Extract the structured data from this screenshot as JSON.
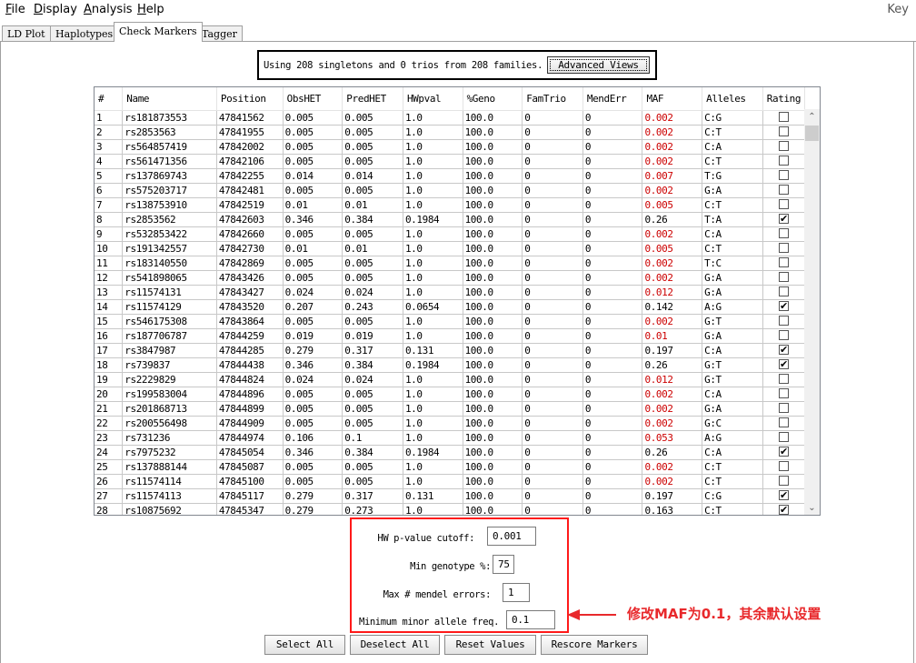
{
  "menubar": {
    "items": [
      "File",
      "Display",
      "Analysis",
      "Help"
    ],
    "right_label": "Key"
  },
  "tabs": [
    "LD Plot",
    "Haplotypes",
    "Check Markers",
    "Tagger"
  ],
  "active_tab": "Check Markers",
  "info": {
    "text": "Using 208 singletons and 0 trios from 208 families.",
    "advanced_button": "Advanced Views"
  },
  "table": {
    "columns": [
      "#",
      "Name",
      "Position",
      "ObsHET",
      "PredHET",
      "HWpval",
      "%Geno",
      "FamTrio",
      "MendErr",
      "MAF",
      "Alleles",
      "Rating"
    ],
    "rows": [
      [
        "1",
        "rs181873553",
        "47841562",
        "0.005",
        "0.005",
        "1.0",
        "100.0",
        "0",
        "0",
        "0.002",
        "C:G",
        false
      ],
      [
        "2",
        "rs2853563",
        "47841955",
        "0.005",
        "0.005",
        "1.0",
        "100.0",
        "0",
        "0",
        "0.002",
        "C:T",
        false
      ],
      [
        "3",
        "rs564857419",
        "47842002",
        "0.005",
        "0.005",
        "1.0",
        "100.0",
        "0",
        "0",
        "0.002",
        "C:A",
        false
      ],
      [
        "4",
        "rs561471356",
        "47842106",
        "0.005",
        "0.005",
        "1.0",
        "100.0",
        "0",
        "0",
        "0.002",
        "C:T",
        false
      ],
      [
        "5",
        "rs137869743",
        "47842255",
        "0.014",
        "0.014",
        "1.0",
        "100.0",
        "0",
        "0",
        "0.007",
        "T:G",
        false
      ],
      [
        "6",
        "rs575203717",
        "47842481",
        "0.005",
        "0.005",
        "1.0",
        "100.0",
        "0",
        "0",
        "0.002",
        "G:A",
        false
      ],
      [
        "7",
        "rs138753910",
        "47842519",
        "0.01",
        "0.01",
        "1.0",
        "100.0",
        "0",
        "0",
        "0.005",
        "C:T",
        false
      ],
      [
        "8",
        "rs2853562",
        "47842603",
        "0.346",
        "0.384",
        "0.1984",
        "100.0",
        "0",
        "0",
        "0.26",
        "T:A",
        true
      ],
      [
        "9",
        "rs532853422",
        "47842660",
        "0.005",
        "0.005",
        "1.0",
        "100.0",
        "0",
        "0",
        "0.002",
        "C:A",
        false
      ],
      [
        "10",
        "rs191342557",
        "47842730",
        "0.01",
        "0.01",
        "1.0",
        "100.0",
        "0",
        "0",
        "0.005",
        "C:T",
        false
      ],
      [
        "11",
        "rs183140550",
        "47842869",
        "0.005",
        "0.005",
        "1.0",
        "100.0",
        "0",
        "0",
        "0.002",
        "T:C",
        false
      ],
      [
        "12",
        "rs541898065",
        "47843426",
        "0.005",
        "0.005",
        "1.0",
        "100.0",
        "0",
        "0",
        "0.002",
        "G:A",
        false
      ],
      [
        "13",
        "rs11574131",
        "47843427",
        "0.024",
        "0.024",
        "1.0",
        "100.0",
        "0",
        "0",
        "0.012",
        "G:A",
        false
      ],
      [
        "14",
        "rs11574129",
        "47843520",
        "0.207",
        "0.243",
        "0.0654",
        "100.0",
        "0",
        "0",
        "0.142",
        "A:G",
        true
      ],
      [
        "15",
        "rs546175308",
        "47843864",
        "0.005",
        "0.005",
        "1.0",
        "100.0",
        "0",
        "0",
        "0.002",
        "G:T",
        false
      ],
      [
        "16",
        "rs187706787",
        "47844259",
        "0.019",
        "0.019",
        "1.0",
        "100.0",
        "0",
        "0",
        "0.01",
        "G:A",
        false
      ],
      [
        "17",
        "rs3847987",
        "47844285",
        "0.279",
        "0.317",
        "0.131",
        "100.0",
        "0",
        "0",
        "0.197",
        "C:A",
        true
      ],
      [
        "18",
        "rs739837",
        "47844438",
        "0.346",
        "0.384",
        "0.1984",
        "100.0",
        "0",
        "0",
        "0.26",
        "G:T",
        true
      ],
      [
        "19",
        "rs2229829",
        "47844824",
        "0.024",
        "0.024",
        "1.0",
        "100.0",
        "0",
        "0",
        "0.012",
        "G:T",
        false
      ],
      [
        "20",
        "rs199583004",
        "47844896",
        "0.005",
        "0.005",
        "1.0",
        "100.0",
        "0",
        "0",
        "0.002",
        "C:A",
        false
      ],
      [
        "21",
        "rs201868713",
        "47844899",
        "0.005",
        "0.005",
        "1.0",
        "100.0",
        "0",
        "0",
        "0.002",
        "G:A",
        false
      ],
      [
        "22",
        "rs200556498",
        "47844909",
        "0.005",
        "0.005",
        "1.0",
        "100.0",
        "0",
        "0",
        "0.002",
        "G:C",
        false
      ],
      [
        "23",
        "rs731236",
        "47844974",
        "0.106",
        "0.1",
        "1.0",
        "100.0",
        "0",
        "0",
        "0.053",
        "A:G",
        false
      ],
      [
        "24",
        "rs7975232",
        "47845054",
        "0.346",
        "0.384",
        "0.1984",
        "100.0",
        "0",
        "0",
        "0.26",
        "C:A",
        true
      ],
      [
        "25",
        "rs137888144",
        "47845087",
        "0.005",
        "0.005",
        "1.0",
        "100.0",
        "0",
        "0",
        "0.002",
        "C:T",
        false
      ],
      [
        "26",
        "rs11574114",
        "47845100",
        "0.005",
        "0.005",
        "1.0",
        "100.0",
        "0",
        "0",
        "0.002",
        "C:T",
        false
      ],
      [
        "27",
        "rs11574113",
        "47845117",
        "0.279",
        "0.317",
        "0.131",
        "100.0",
        "0",
        "0",
        "0.197",
        "C:G",
        true
      ],
      [
        "28",
        "rs10875692",
        "47845347",
        "0.279",
        "0.273",
        "1.0",
        "100.0",
        "0",
        "0",
        "0.163",
        "C:T",
        true
      ]
    ],
    "low_maf_color": "#cc0000"
  },
  "params": {
    "hw_label": "HW p-value cutoff:",
    "hw_value": "0.001",
    "geno_label": "Min genotype %:",
    "geno_value": "75",
    "mendel_label": "Max # mendel errors:",
    "mendel_value": "1",
    "maf_label": "Minimum minor allele freq.",
    "maf_value": "0.1"
  },
  "buttons": {
    "select_all": "Select All",
    "deselect_all": "Deselect All",
    "reset_values": "Reset Values",
    "rescore_markers": "Rescore Markers"
  },
  "annotation": {
    "text": "修改MAF为0.1，其余默认设置",
    "color": "#e8292c"
  }
}
